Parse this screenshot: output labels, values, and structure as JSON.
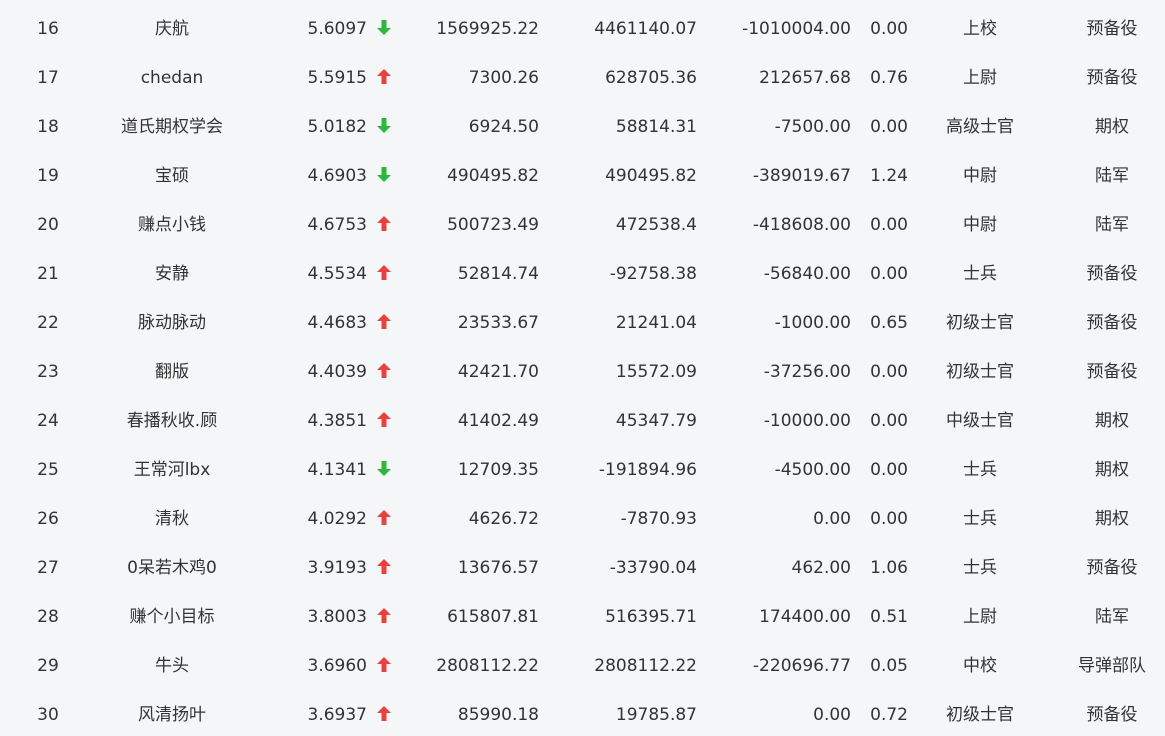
{
  "colors": {
    "up": "#e8413e",
    "down": "#2db83d"
  },
  "rows": [
    {
      "rank": "16",
      "name": "庆航",
      "score": "5.6097",
      "trend": "down",
      "v1": "1569925.22",
      "v2": "4461140.07",
      "v3": "-1010004.00",
      "v4": "0.00",
      "rank_title": "上校",
      "group": "预备役"
    },
    {
      "rank": "17",
      "name": "chedan",
      "score": "5.5915",
      "trend": "up",
      "v1": "7300.26",
      "v2": "628705.36",
      "v3": "212657.68",
      "v4": "0.76",
      "rank_title": "上尉",
      "group": "预备役"
    },
    {
      "rank": "18",
      "name": "道氏期权学会",
      "score": "5.0182",
      "trend": "down",
      "v1": "6924.50",
      "v2": "58814.31",
      "v3": "-7500.00",
      "v4": "0.00",
      "rank_title": "高级士官",
      "group": "期权"
    },
    {
      "rank": "19",
      "name": "宝硕",
      "score": "4.6903",
      "trend": "down",
      "v1": "490495.82",
      "v2": "490495.82",
      "v3": "-389019.67",
      "v4": "1.24",
      "rank_title": "中尉",
      "group": "陆军"
    },
    {
      "rank": "20",
      "name": "赚点小钱",
      "score": "4.6753",
      "trend": "up",
      "v1": "500723.49",
      "v2": "472538.4",
      "v3": "-418608.00",
      "v4": "0.00",
      "rank_title": "中尉",
      "group": "陆军"
    },
    {
      "rank": "21",
      "name": "安静",
      "score": "4.5534",
      "trend": "up",
      "v1": "52814.74",
      "v2": "-92758.38",
      "v3": "-56840.00",
      "v4": "0.00",
      "rank_title": "士兵",
      "group": "预备役"
    },
    {
      "rank": "22",
      "name": "脉动脉动",
      "score": "4.4683",
      "trend": "up",
      "v1": "23533.67",
      "v2": "21241.04",
      "v3": "-1000.00",
      "v4": "0.65",
      "rank_title": "初级士官",
      "group": "预备役"
    },
    {
      "rank": "23",
      "name": "翻版",
      "score": "4.4039",
      "trend": "up",
      "v1": "42421.70",
      "v2": "15572.09",
      "v3": "-37256.00",
      "v4": "0.00",
      "rank_title": "初级士官",
      "group": "预备役"
    },
    {
      "rank": "24",
      "name": "春播秋收.顾",
      "score": "4.3851",
      "trend": "up",
      "v1": "41402.49",
      "v2": "45347.79",
      "v3": "-10000.00",
      "v4": "0.00",
      "rank_title": "中级士官",
      "group": "期权"
    },
    {
      "rank": "25",
      "name": "王常河lbx",
      "score": "4.1341",
      "trend": "down",
      "v1": "12709.35",
      "v2": "-191894.96",
      "v3": "-4500.00",
      "v4": "0.00",
      "rank_title": "士兵",
      "group": "期权"
    },
    {
      "rank": "26",
      "name": "清秋",
      "score": "4.0292",
      "trend": "up",
      "v1": "4626.72",
      "v2": "-7870.93",
      "v3": "0.00",
      "v4": "0.00",
      "rank_title": "士兵",
      "group": "期权"
    },
    {
      "rank": "27",
      "name": "0呆若木鸡0",
      "score": "3.9193",
      "trend": "up",
      "v1": "13676.57",
      "v2": "-33790.04",
      "v3": "462.00",
      "v4": "1.06",
      "rank_title": "士兵",
      "group": "预备役"
    },
    {
      "rank": "28",
      "name": "赚个小目标",
      "score": "3.8003",
      "trend": "up",
      "v1": "615807.81",
      "v2": "516395.71",
      "v3": "174400.00",
      "v4": "0.51",
      "rank_title": "上尉",
      "group": "陆军"
    },
    {
      "rank": "29",
      "name": "牛头",
      "score": "3.6960",
      "trend": "up",
      "v1": "2808112.22",
      "v2": "2808112.22",
      "v3": "-220696.77",
      "v4": "0.05",
      "rank_title": "中校",
      "group": "导弹部队"
    },
    {
      "rank": "30",
      "name": "风清扬叶",
      "score": "3.6937",
      "trend": "up",
      "v1": "85990.18",
      "v2": "19785.87",
      "v3": "0.00",
      "v4": "0.72",
      "rank_title": "初级士官",
      "group": "预备役"
    }
  ]
}
